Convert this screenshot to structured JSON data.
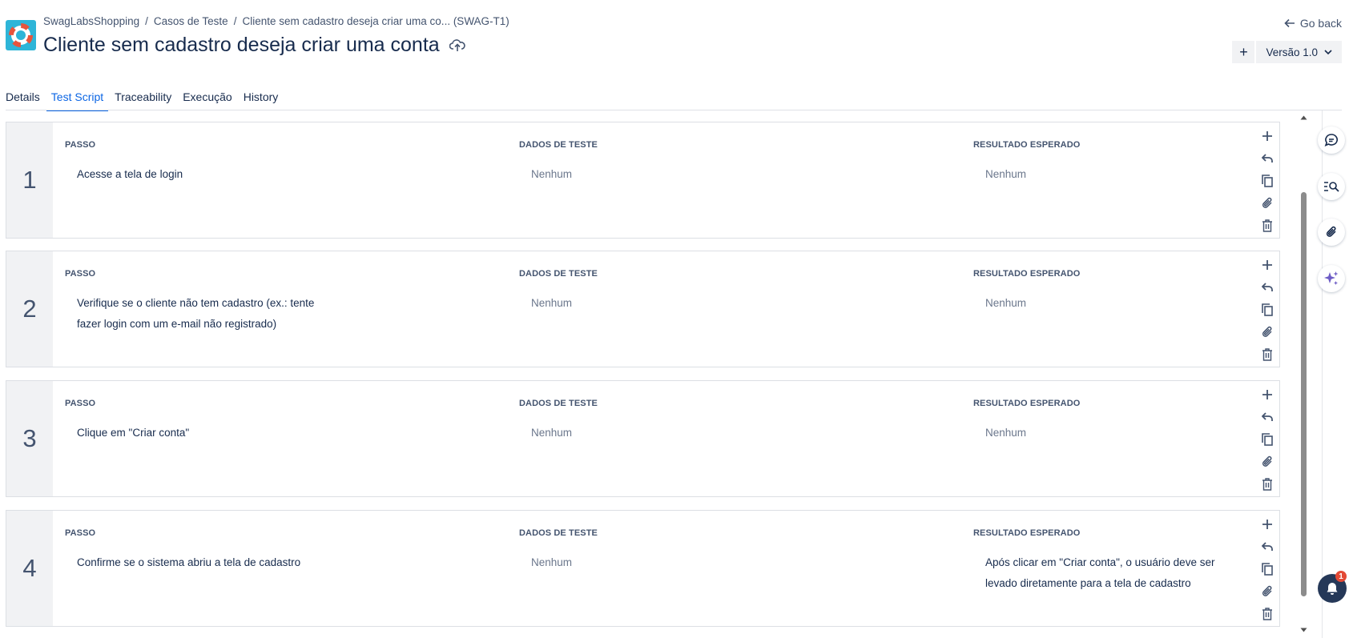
{
  "header": {
    "breadcrumb": [
      "SwagLabsShopping",
      "Casos de Teste",
      "Cliente sem cadastro deseja criar uma co... (SWAG-T1)"
    ],
    "title": "Cliente sem cadastro deseja criar uma conta",
    "go_back": "Go back",
    "version_label": "Versão 1.0"
  },
  "tabs": [
    "Details",
    "Test Script",
    "Traceability",
    "Execução",
    "History"
  ],
  "active_tab": "Test Script",
  "columns": {
    "step": "PASSO",
    "data": "DADOS DE TESTE",
    "result": "RESULTADO ESPERADO"
  },
  "steps": [
    {
      "number": "1",
      "step": "Acesse a tela de login",
      "data": "Nenhum",
      "result": "Nenhum"
    },
    {
      "number": "2",
      "step": "Verifique se o cliente não tem cadastro (ex.: tente fazer login com um e-mail não registrado)",
      "data": "Nenhum",
      "result": "Nenhum"
    },
    {
      "number": "3",
      "step": "Clique em \"Criar conta\"",
      "data": "Nenhum",
      "result": "Nenhum"
    },
    {
      "number": "4",
      "step": "Confirme se o sistema abriu a tela de cadastro",
      "data": "Nenhum",
      "result": "Após clicar em \"Criar conta\", o usuário deve ser levado diretamente para a tela de cadastro"
    }
  ],
  "notifications": {
    "count": "1"
  },
  "colors": {
    "accent": "#0c66e4",
    "logo_bg": "#2eb5d8",
    "ai_icon": "#6e5dc6",
    "badge": "#e34935"
  },
  "icons": [
    "logo-lifebuoy-icon",
    "cloud-upload-icon",
    "arrow-left-icon",
    "plus-icon",
    "chevron-down-icon",
    "add-step-icon",
    "undo-icon",
    "copy-icon",
    "attachment-icon",
    "delete-icon",
    "comment-icon",
    "search-list-icon",
    "sparkle-ai-icon",
    "bell-icon"
  ]
}
